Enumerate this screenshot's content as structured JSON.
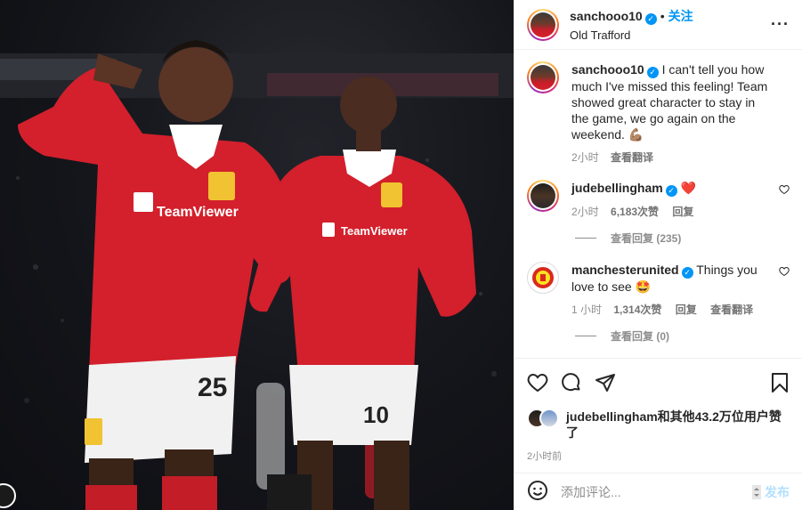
{
  "colors": {
    "accent": "#0095f6",
    "heart_red": "#ed4956",
    "jersey_red": "#d3202c"
  },
  "header": {
    "username": "sanchooo10",
    "separator": "•",
    "follow_label": "关注",
    "location": "Old Trafford",
    "more_icon": "more-horizontal-icon"
  },
  "caption": {
    "username": "sanchooo10",
    "text": "I can't tell you how much I've missed this feeling! Team showed great character to stay in the game, we go again on the weekend.",
    "emoji": "💪🏽",
    "time": "2小时",
    "translate_label": "查看翻译"
  },
  "comments": [
    {
      "username": "judebellingham",
      "text": "❤️",
      "time": "2小时",
      "likes": "6,183次赞",
      "reply_label": "回复",
      "view_replies": "查看回复 (235)"
    },
    {
      "username": "manchesterunited",
      "text": "Things you love to see",
      "emoji": "🤩",
      "time": "1 小时",
      "likes": "1,314次赞",
      "reply_label": "回复",
      "translate_label": "查看翻译",
      "view_replies": "查看回复 (0)"
    }
  ],
  "likes_summary": {
    "text": "judebellingham和其他43.2万位用户赞了"
  },
  "post_time": "2小时前",
  "add_comment": {
    "placeholder": "添加评论...",
    "post_label": "发布"
  },
  "photo": {
    "sponsor_text": "TeamViewer",
    "player_numbers": [
      "25",
      "10"
    ]
  }
}
